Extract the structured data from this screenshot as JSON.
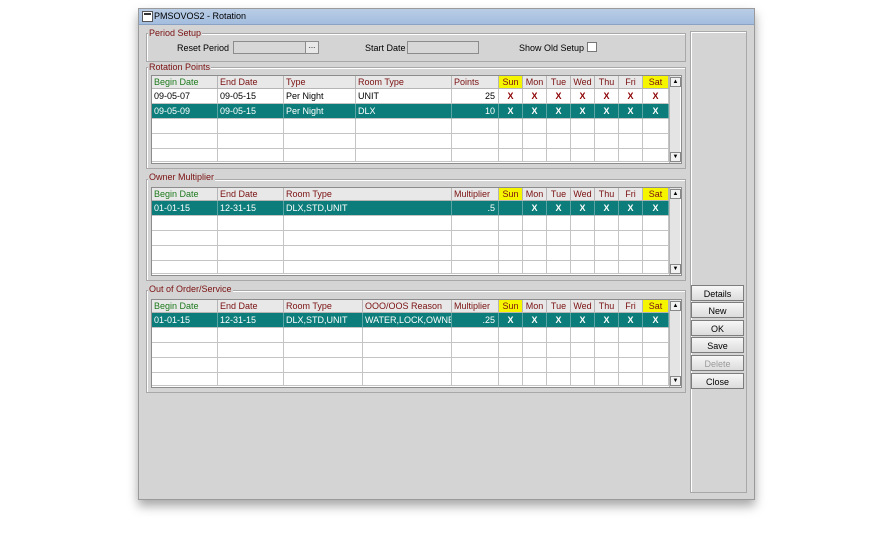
{
  "window": {
    "title": "PMSOVOS2 - Rotation"
  },
  "period_setup": {
    "legend": "Period Setup",
    "reset_period_label": "Reset Period",
    "lov_label": "...",
    "start_date_label": "Start Date",
    "show_old_setup_label": "Show Old Setup",
    "show_old_setup_checked": false
  },
  "rotation_points": {
    "legend": "Rotation Points",
    "headers": [
      "Begin Date",
      "End Date",
      "Type",
      "Room Type",
      "Points",
      "Sun",
      "Mon",
      "Tue",
      "Wed",
      "Thu",
      "Fri",
      "Sat"
    ],
    "rows": [
      [
        "09-05-07",
        "09-05-15",
        "Per Night",
        "UNIT",
        "25",
        "X",
        "X",
        "X",
        "X",
        "X",
        "X",
        "X"
      ],
      [
        "09-05-09",
        "09-05-15",
        "Per Night",
        "DLX",
        "10",
        "X",
        "X",
        "X",
        "X",
        "X",
        "X",
        "X"
      ]
    ],
    "selected_row": 1
  },
  "owner_multiplier": {
    "legend": "Owner Multiplier",
    "headers": [
      "Begin Date",
      "End Date",
      "Room Type",
      "Multiplier",
      "Sun",
      "Mon",
      "Tue",
      "Wed",
      "Thu",
      "Fri",
      "Sat"
    ],
    "rows": [
      [
        "01-01-15",
        "12-31-15",
        "DLX,STD,UNIT",
        ".5",
        "",
        "X",
        "X",
        "X",
        "X",
        "X",
        "X"
      ]
    ],
    "selected_row": 0
  },
  "out_of_order": {
    "legend": "Out of Order/Service",
    "headers": [
      "Begin Date",
      "End Date",
      "Room Type",
      "OOO/OOS Reason",
      "Multiplier",
      "Sun",
      "Mon",
      "Tue",
      "Wed",
      "Thu",
      "Fri",
      "Sat"
    ],
    "rows": [
      [
        "01-01-15",
        "12-31-15",
        "DLX,STD,UNIT",
        "WATER,LOCK,OWNER",
        ".25",
        "X",
        "X",
        "X",
        "X",
        "X",
        "X",
        "X"
      ]
    ],
    "selected_row": 0
  },
  "buttons": {
    "details": "Details",
    "new": "New",
    "ok": "OK",
    "save": "Save",
    "delete": "Delete",
    "close": "Close"
  },
  "colors": {
    "selected_row": "#0c7d7a",
    "weekend_header": "#f5f500",
    "label": "#7a1010",
    "begin_date_header": "#1c7a1c"
  },
  "icons": {
    "window": "app-window-icon",
    "scroll_up": "scroll-up-icon",
    "scroll_down": "scroll-down-icon"
  }
}
